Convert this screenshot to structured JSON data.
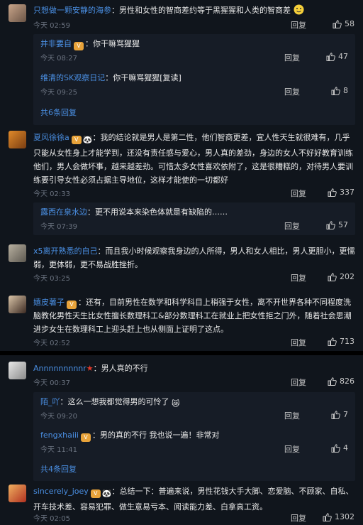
{
  "comments": [
    {
      "name": "只想做一颗安静的海参",
      "text": "：男性和女性的智商差约等于黑猩猩和人类的智商差",
      "time": "今天 02:59",
      "reply": "回复",
      "likes": "58",
      "subs": [
        {
          "name": "井非要自",
          "text": "：你干嘛骂猩猩",
          "time": "今天 08:27",
          "reply": "回复",
          "likes": "47"
        },
        {
          "name": "维清的SK观察日记",
          "text": "：你干嘛骂猩猩[复读]",
          "time": "今天 09:25",
          "reply": "回复",
          "likes": "8"
        }
      ],
      "more": "共6条回复"
    },
    {
      "name": "夏风徐徐a",
      "text": "：我的结论就是男人是第二性，他们智商更差，宜人性天生就很难有，几乎只能从女性身上才能学到，还没有责任感与爱心，男人真的差劲，身边的女人不好好教育训练他们，男人会做坏事，越来越差劲。可惜太多女性喜欢依附了，这是很糟糕的，对待男人要训练要引导女性必须占据主导地位，这样才能使的一切都好",
      "time": "今天 02:33",
      "reply": "回复",
      "likes": "337",
      "subs": [
        {
          "name": "露西在泉水边",
          "text": "：更不用说本来染色体就是有缺陷的……",
          "time": "今天 07:39",
          "reply": "回复",
          "likes": "57"
        }
      ]
    },
    {
      "name": "x5离开熟悉的自己",
      "text": "：而且我小时候观察我身边的人所得，男人和女人相比，男人更胆小，更懦弱，更体弱，更不易战胜挫折。",
      "time": "今天 03:25",
      "reply": "回复",
      "likes": "202"
    },
    {
      "name": "嬉皮薯子",
      "text": "：还有，目前男性在数学和科学科目上稍强于女性，离不开世界各种不同程度洗脑教化男性天生比女性擅长数理科工&部分数理科工在就业上把女性拒之门外，随着社会思潮进步女生在数理科工上迎头赶上也从侧面上证明了这点。",
      "time": "今天 02:52",
      "reply": "回复",
      "likes": "713"
    },
    {
      "name": "Annnnnnnnnr",
      "text": "：男人真的不行",
      "time": "今天 00:37",
      "reply": "回复",
      "likes": "826",
      "subs": [
        {
          "name": "陌_吖",
          "text": "：这么一想我都觉得男的可怜了",
          "time": "今天 09:20",
          "reply": "回复",
          "likes": "7"
        },
        {
          "name": "fengxhaiii",
          "text": "：男的真的不行 我也说一遍！非常对",
          "time": "今天 11:41",
          "reply": "回复",
          "likes": "4"
        }
      ],
      "more": "共4条回复"
    },
    {
      "name": "sincerely_joey",
      "text": "：总结一下：普遍来说，男性花钱大手大脚、恋爱脑、不顾家、自私、开车技术差、容易犯罪、做生意易亏本、阅读能力差、白拿高工资。",
      "time": "今天 02:05",
      "reply": "回复",
      "likes": "1302"
    }
  ],
  "colors": {
    "link": "#4a8fe3",
    "bg": "#10151c",
    "subbg": "#161c26"
  },
  "icons": {
    "like": "thumb-up-icon",
    "badge": "vip-badge-icon"
  }
}
